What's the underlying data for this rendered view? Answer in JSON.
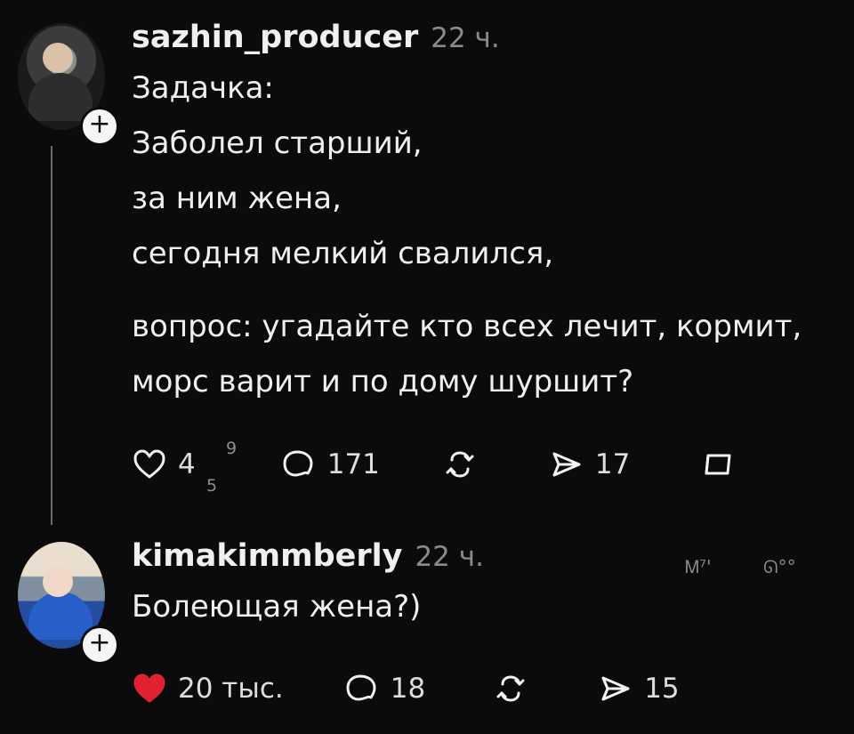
{
  "posts": [
    {
      "username": "sazhin_producer",
      "time": "22 ч.",
      "lines": [
        "Задачка:",
        "Заболел старший,",
        "за ним жена,",
        "сегодня мелкий свалился,",
        "",
        "вопрос: угадайте кто всех лечит, кормит,",
        "морс варит и по дому шуршит?"
      ],
      "actions": {
        "like_count": "4",
        "reply_count": "171",
        "repost_count": "",
        "share_count": "17"
      },
      "extras": {
        "small_a": "9",
        "small_b": "5"
      }
    },
    {
      "username": "kimakimmberly",
      "time": "22 ч.",
      "lines": [
        "Болеющая жена?)"
      ],
      "actions": {
        "like_count": "20 тыс.",
        "reply_count": "18",
        "repost_count": "",
        "share_count": "15"
      },
      "extras": {
        "corner_left": "Ꮇ⁷'",
        "corner_right": "ᘏ°°"
      }
    }
  ],
  "icons": {
    "follow": "+",
    "heart": "heart-icon",
    "reply": "reply-icon",
    "repost": "repost-icon",
    "share": "share-icon",
    "bookmark": "bookmark-icon"
  },
  "colors": {
    "background": "#0b0b0c",
    "primary_text": "#efefef",
    "muted_text": "#8a8a8a",
    "liked": "#e0212f"
  }
}
